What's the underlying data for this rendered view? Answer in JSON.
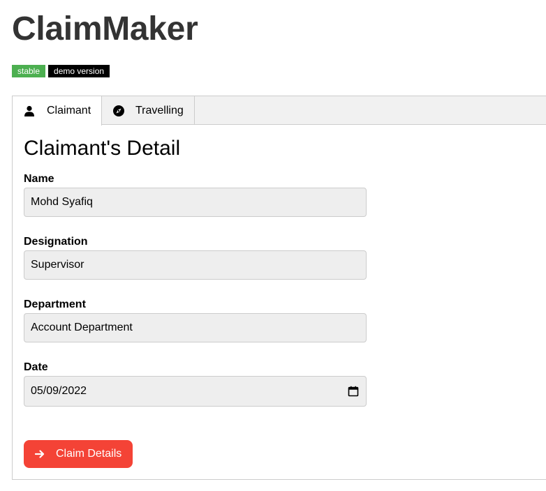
{
  "app": {
    "title": "ClaimMaker",
    "badges": {
      "stable": "stable",
      "demo": "demo version"
    }
  },
  "tabs": [
    {
      "label": "Claimant",
      "icon": "user-icon",
      "active": true
    },
    {
      "label": "Travelling",
      "icon": "compass-icon",
      "active": false
    }
  ],
  "form": {
    "title": "Claimant's Detail",
    "name": {
      "label": "Name",
      "value": "Mohd Syafiq"
    },
    "designation": {
      "label": "Designation",
      "value": "Supervisor"
    },
    "department": {
      "label": "Department",
      "value": "Account Department"
    },
    "date": {
      "label": "Date",
      "value": "05/09/2022"
    },
    "submit_label": "Claim Details"
  },
  "colors": {
    "accent_button": "#f44336",
    "badge_stable": "#4caf50",
    "badge_demo": "#000000",
    "title_text": "#333333"
  }
}
